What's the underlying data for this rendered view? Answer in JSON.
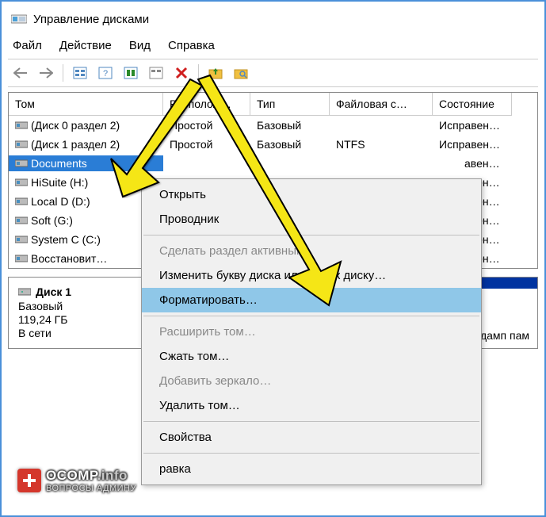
{
  "title": "Управление дисками",
  "menu": {
    "file": "Файл",
    "action": "Действие",
    "view": "Вид",
    "help": "Справка"
  },
  "columns": {
    "vol": "Том",
    "layout": "Располож…",
    "type": "Тип",
    "fs": "Файловая с…",
    "status": "Состояние"
  },
  "rows": [
    {
      "name": "(Диск 0 раздел 2)",
      "layout": "Простой",
      "type": "Базовый",
      "fs": "",
      "status": "Исправен…"
    },
    {
      "name": "(Диск 1 раздел 2)",
      "layout": "Простой",
      "type": "Базовый",
      "fs": "NTFS",
      "status": "Исправен…"
    },
    {
      "name": "Documents",
      "status_tail": "авен…",
      "selected": true
    },
    {
      "name": "HiSuite (H:)",
      "status_tail": "авен…"
    },
    {
      "name": "Local D (D:)",
      "status_tail": "авен…"
    },
    {
      "name": "Soft (G:)",
      "status_tail": "авен…"
    },
    {
      "name": "System C (C:)",
      "status_tail": "авен…"
    },
    {
      "name": "Восстановит…",
      "status_tail": "авен…"
    }
  ],
  "context": {
    "open": "Открыть",
    "explorer": "Проводник",
    "active": "Сделать раздел активным",
    "letter": "Изменить букву диска или путь к диску…",
    "format": "Форматировать…",
    "extend": "Расширить том…",
    "shrink": "Сжать том…",
    "mirror": "Добавить зеркало…",
    "delete": "Удалить том…",
    "props": "Свойства",
    "help": "равка"
  },
  "disk": {
    "title": "Диск 1",
    "type": "Базовый",
    "size": "119,24 ГБ",
    "online": "В сети",
    "tail": "дамп пам"
  },
  "watermark": {
    "brand": "OCOMP",
    "suffix": ".info",
    "sub": "ВОПРОСЫ АДМИНУ"
  }
}
